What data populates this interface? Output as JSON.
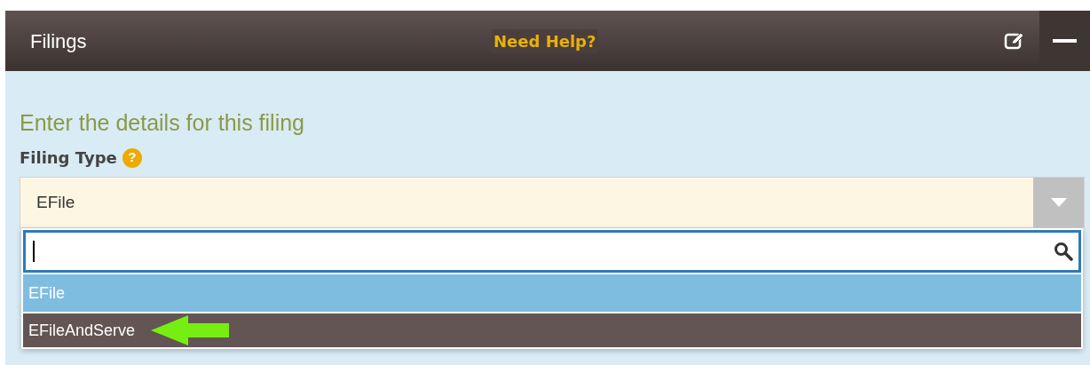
{
  "header": {
    "title": "Filings",
    "help_link": "Need Help?"
  },
  "form": {
    "heading": "Enter the details for this filing",
    "label": "Filing Type",
    "help_icon": "?"
  },
  "select": {
    "value": "EFile",
    "expanded": true
  },
  "dropdown": {
    "search": {
      "focused": true
    },
    "options": [
      {
        "label": "EFile",
        "selected": true,
        "hovered": false,
        "pointer_arrow": false
      },
      {
        "label": "EFileAndServe",
        "selected": false,
        "hovered": true,
        "pointer_arrow": true
      }
    ]
  }
}
